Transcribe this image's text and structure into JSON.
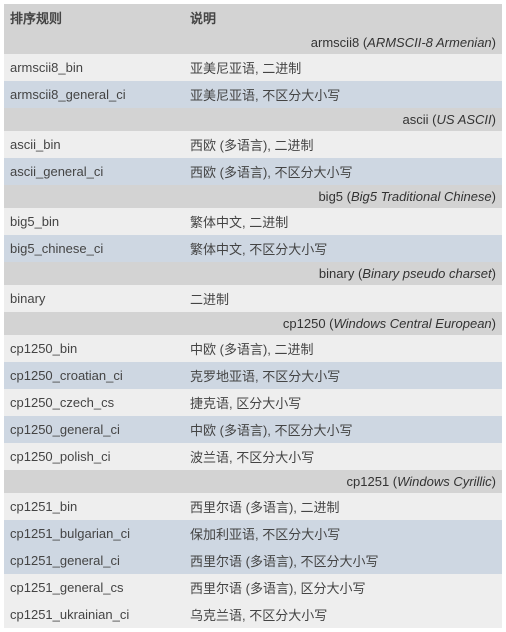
{
  "headers": {
    "col1": "排序规则",
    "col2": "说明"
  },
  "groups": [
    {
      "name": "armscii8",
      "desc": "ARMSCII-8 Armenian",
      "rows": [
        {
          "k": "armscii8_bin",
          "v": "亚美尼亚语, 二进制",
          "shade": "light"
        },
        {
          "k": "armscii8_general_ci",
          "v": "亚美尼亚语, 不区分大小写",
          "shade": "dark"
        }
      ]
    },
    {
      "name": "ascii",
      "desc": "US ASCII",
      "rows": [
        {
          "k": "ascii_bin",
          "v": "西欧 (多语言), 二进制",
          "shade": "light"
        },
        {
          "k": "ascii_general_ci",
          "v": "西欧 (多语言), 不区分大小写",
          "shade": "dark"
        }
      ]
    },
    {
      "name": "big5",
      "desc": "Big5 Traditional Chinese",
      "rows": [
        {
          "k": "big5_bin",
          "v": "繁体中文, 二进制",
          "shade": "light"
        },
        {
          "k": "big5_chinese_ci",
          "v": "繁体中文, 不区分大小写",
          "shade": "dark"
        }
      ]
    },
    {
      "name": "binary",
      "desc": "Binary pseudo charset",
      "rows": [
        {
          "k": "binary",
          "v": "二进制",
          "shade": "light"
        }
      ]
    },
    {
      "name": "cp1250",
      "desc": "Windows Central European",
      "rows": [
        {
          "k": "cp1250_bin",
          "v": "中欧 (多语言), 二进制",
          "shade": "light"
        },
        {
          "k": "cp1250_croatian_ci",
          "v": "克罗地亚语, 不区分大小写",
          "shade": "dark"
        },
        {
          "k": "cp1250_czech_cs",
          "v": "捷克语, 区分大小写",
          "shade": "light"
        },
        {
          "k": "cp1250_general_ci",
          "v": "中欧 (多语言), 不区分大小写",
          "shade": "dark"
        },
        {
          "k": "cp1250_polish_ci",
          "v": "波兰语, 不区分大小写",
          "shade": "light"
        }
      ]
    },
    {
      "name": "cp1251",
      "desc": "Windows Cyrillic",
      "rows": [
        {
          "k": "cp1251_bin",
          "v": "西里尔语 (多语言), 二进制",
          "shade": "light"
        },
        {
          "k": "cp1251_bulgarian_ci",
          "v": "保加利亚语, 不区分大小写",
          "shade": "dark"
        },
        {
          "k": "cp1251_general_ci",
          "v": "西里尔语 (多语言), 不区分大小写",
          "shade": "dark"
        },
        {
          "k": "cp1251_general_cs",
          "v": "西里尔语 (多语言), 区分大小写",
          "shade": "light"
        },
        {
          "k": "cp1251_ukrainian_ci",
          "v": "乌克兰语, 不区分大小写",
          "shade": "light"
        }
      ]
    }
  ]
}
